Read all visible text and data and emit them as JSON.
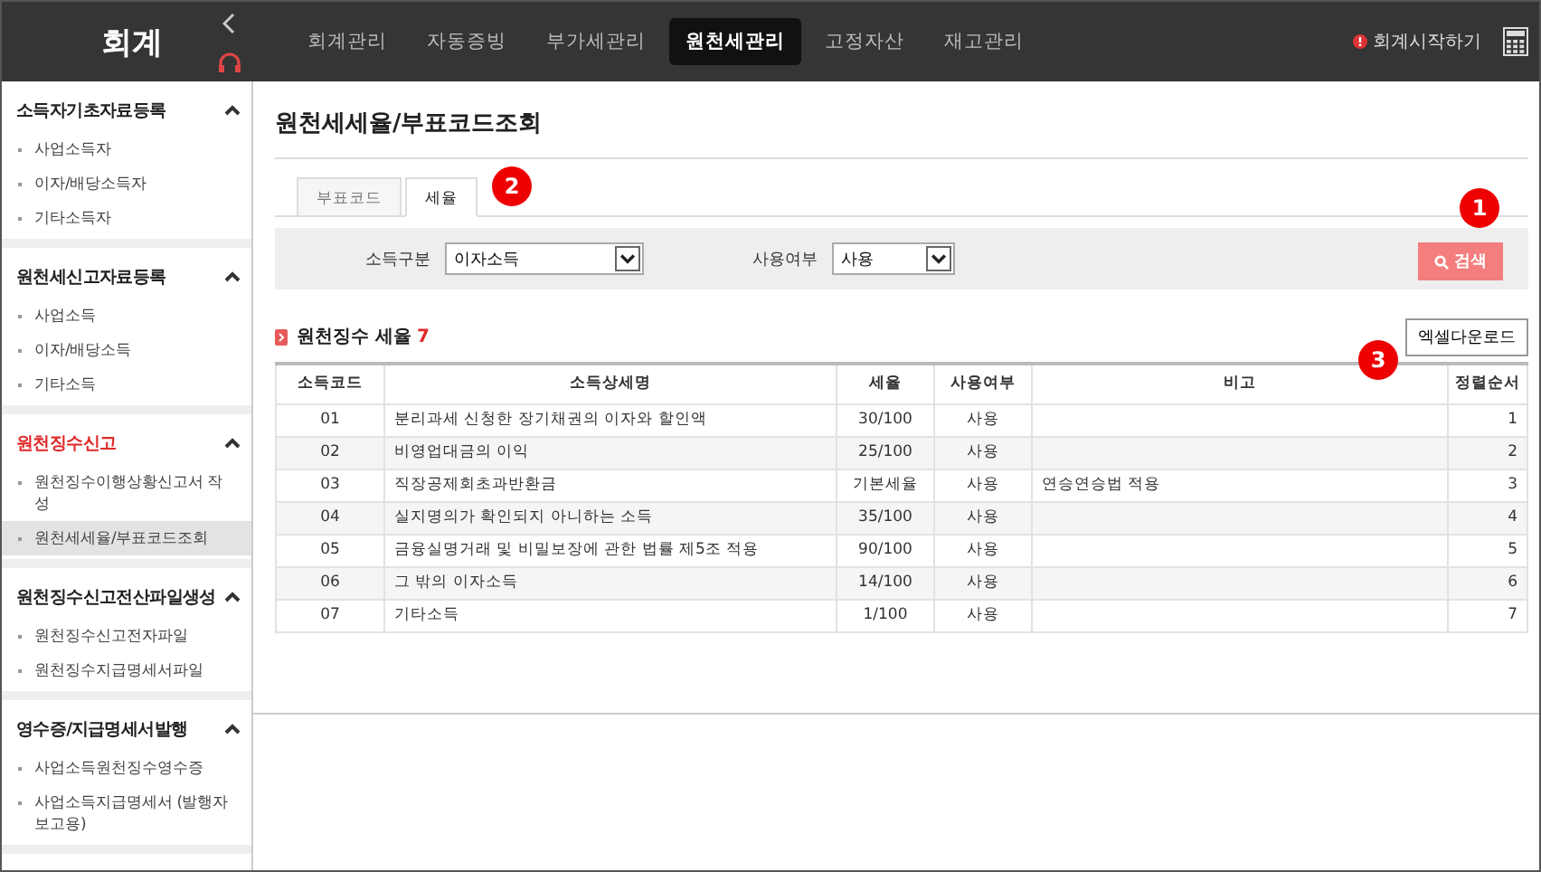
{
  "app_title": "회계",
  "nav": [
    {
      "label": "회계관리",
      "selected": false
    },
    {
      "label": "자동증빙",
      "selected": false
    },
    {
      "label": "부가세관리",
      "selected": false
    },
    {
      "label": "원천세관리",
      "selected": true
    },
    {
      "label": "고정자산",
      "selected": false
    },
    {
      "label": "재고관리",
      "selected": false
    }
  ],
  "start_link": "회계시작하기",
  "sidebar": [
    {
      "title": "소득자기초자료등록",
      "active": false,
      "expanded": true,
      "items": [
        {
          "label": "사업소득자",
          "selected": false
        },
        {
          "label": "이자/배당소득자",
          "selected": false
        },
        {
          "label": "기타소득자",
          "selected": false
        }
      ]
    },
    {
      "title": "원천세신고자료등록",
      "active": false,
      "expanded": true,
      "items": [
        {
          "label": "사업소득",
          "selected": false
        },
        {
          "label": "이자/배당소득",
          "selected": false
        },
        {
          "label": "기타소득",
          "selected": false
        }
      ]
    },
    {
      "title": "원천징수신고",
      "active": true,
      "expanded": true,
      "items": [
        {
          "label": "원천징수이행상황신고서 작성",
          "selected": false
        },
        {
          "label": "원천세세율/부표코드조회",
          "selected": true
        }
      ]
    },
    {
      "title": "원천징수신고전산파일생성",
      "active": false,
      "expanded": true,
      "items": [
        {
          "label": "원천징수신고전자파일",
          "selected": false
        },
        {
          "label": "원천징수지급명세서파일",
          "selected": false
        }
      ]
    },
    {
      "title": "영수증/지급명세서발행",
      "active": false,
      "expanded": true,
      "items": [
        {
          "label": "사업소득원천징수영수증",
          "selected": false
        },
        {
          "label": "사업소득지급명세서 (발행자보고용)",
          "selected": false
        }
      ]
    }
  ],
  "page_title": "원천세세율/부표코드조회",
  "tabs": [
    {
      "label": "부표코드",
      "selected": false
    },
    {
      "label": "세율",
      "selected": true
    }
  ],
  "filters": [
    {
      "label": "소득구분",
      "value": "이자소득"
    },
    {
      "label": "사용여부",
      "value": "사용"
    }
  ],
  "search_button": "검색",
  "section_title": "원천징수 세율",
  "count": "7",
  "excel_button": "엑셀다운로드",
  "callouts": [
    "1",
    "2",
    "3"
  ],
  "table": {
    "columns": [
      "소득코드",
      "소득상세명",
      "세율",
      "사용여부",
      "비고",
      "정렬순서"
    ],
    "rows": [
      [
        "01",
        "분리과세 신청한 장기채권의 이자와 할인액",
        "30/100",
        "사용",
        "",
        "1"
      ],
      [
        "02",
        "비영업대금의 이익",
        "25/100",
        "사용",
        "",
        "2"
      ],
      [
        "03",
        "직장공제회초과반환금",
        "기본세율",
        "사용",
        "연승연승법 적용",
        "3"
      ],
      [
        "04",
        "실지명의가 확인되지 아니하는 소득",
        "35/100",
        "사용",
        "",
        "4"
      ],
      [
        "05",
        "금융실명거래 및 비밀보장에 관한 법률 제5조 적용",
        "90/100",
        "사용",
        "",
        "5"
      ],
      [
        "06",
        "그 밖의 이자소득",
        "14/100",
        "사용",
        "",
        "6"
      ],
      [
        "07",
        "기타소득",
        "1/100",
        "사용",
        "",
        "7"
      ]
    ]
  }
}
